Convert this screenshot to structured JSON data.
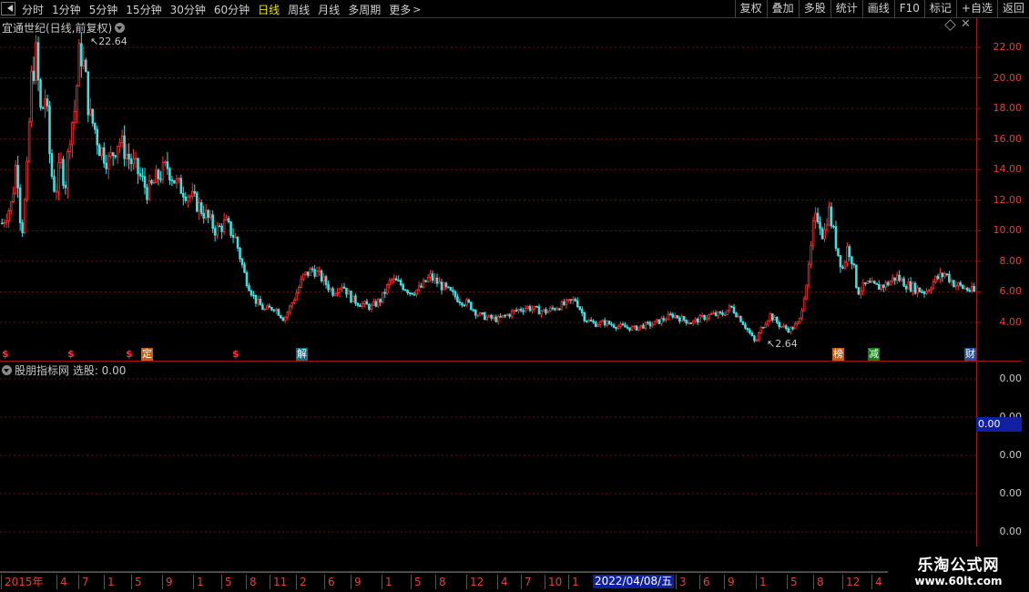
{
  "toolbar": {
    "periods": [
      {
        "label": "分时",
        "active": false
      },
      {
        "label": "1分钟",
        "active": false
      },
      {
        "label": "5分钟",
        "active": false
      },
      {
        "label": "15分钟",
        "active": false
      },
      {
        "label": "30分钟",
        "active": false
      },
      {
        "label": "60分钟",
        "active": false
      },
      {
        "label": "日线",
        "active": true
      },
      {
        "label": "周线",
        "active": false
      },
      {
        "label": "月线",
        "active": false
      },
      {
        "label": "多周期",
        "active": false
      },
      {
        "label": "更多",
        "active": false
      }
    ],
    "more_arrow": ">",
    "actions": [
      "复权",
      "叠加",
      "多股",
      "统计",
      "画线",
      "F10",
      "标记",
      "+自选",
      "返回"
    ]
  },
  "price_panel": {
    "title": "宜通世纪(日线,前复权)",
    "close_glyph": "✕",
    "y_labels": [
      "22.00",
      "20.00",
      "18.00",
      "16.00",
      "14.00",
      "12.00",
      "10.00",
      "8.00",
      "6.00",
      "4.00"
    ],
    "high_annotation": "22.64",
    "low_annotation": "2.64",
    "markers": [
      {
        "label": "$",
        "kind": "dollar",
        "color": "#ff3030"
      },
      {
        "label": "$",
        "kind": "dollar",
        "color": "#ff3030"
      },
      {
        "label": "$",
        "kind": "dollar",
        "color": "#ff3030"
      },
      {
        "label": "定",
        "kind": "box",
        "color": "#c06010"
      },
      {
        "label": "$",
        "kind": "dollar",
        "color": "#ff3030"
      },
      {
        "label": "解",
        "kind": "box",
        "color": "#107080"
      },
      {
        "label": "榜",
        "kind": "box",
        "color": "#c06010"
      },
      {
        "label": "减",
        "kind": "box",
        "color": "#108010"
      },
      {
        "label": "财",
        "kind": "box",
        "color": "#2050a0"
      }
    ]
  },
  "indicator_panel": {
    "title": "股朋指标网 选股: 0.00",
    "y_labels": [
      "0.00",
      "0.00",
      "0.00",
      "0.00",
      "0.00"
    ],
    "current_value": "0.00"
  },
  "time_axis": {
    "ticks": [
      "2015年",
      "4",
      "7",
      "1",
      "5",
      "9",
      "1",
      "5",
      "8",
      "11",
      "2",
      "6",
      "9",
      "1",
      "5",
      "8",
      "12",
      "4",
      "7",
      "10",
      "1",
      "3",
      "6",
      "9",
      "1",
      "5",
      "8",
      "12",
      "4"
    ],
    "cursor_date": "2022/04/08/五"
  },
  "watermark": {
    "title": "乐淘公式网",
    "url": "www.60lt.com"
  },
  "colors": {
    "up_candle": "#ff3030",
    "down_candle": "#40e0e0",
    "grid": "#7a1010",
    "axis_text": "#e04040",
    "cursor_bg": "#1020a0",
    "active_period": "#e8e800"
  },
  "chart_data": {
    "type": "candlestick",
    "title": "宜通世纪(日线,前复权)",
    "ylim": [
      2.0,
      23.5
    ],
    "y_ticks": [
      4,
      6,
      8,
      10,
      12,
      14,
      16,
      18,
      20,
      22
    ],
    "series": [
      {
        "name": "",
        "points": [
          [
            0,
            10.5
          ],
          [
            0.01,
            11.8
          ],
          [
            0.015,
            14.8
          ],
          [
            0.02,
            9.5
          ],
          [
            0.025,
            13.0
          ],
          [
            0.03,
            19.8
          ],
          [
            0.035,
            21.5
          ],
          [
            0.04,
            17.5
          ],
          [
            0.045,
            19.0
          ],
          [
            0.05,
            14.0
          ],
          [
            0.055,
            12.5
          ],
          [
            0.06,
            14.5
          ],
          [
            0.065,
            13.0
          ],
          [
            0.07,
            16.5
          ],
          [
            0.075,
            18.0
          ],
          [
            0.08,
            22.0
          ],
          [
            0.085,
            20.5
          ],
          [
            0.09,
            17.5
          ],
          [
            0.095,
            16.8
          ],
          [
            0.1,
            15.5
          ],
          [
            0.11,
            14.5
          ],
          [
            0.12,
            16.0
          ],
          [
            0.13,
            14.8
          ],
          [
            0.14,
            13.8
          ],
          [
            0.15,
            12.5
          ],
          [
            0.16,
            13.5
          ],
          [
            0.17,
            14.2
          ],
          [
            0.18,
            13.0
          ],
          [
            0.19,
            12.5
          ],
          [
            0.2,
            11.8
          ],
          [
            0.21,
            11.0
          ],
          [
            0.22,
            10.0
          ],
          [
            0.23,
            10.5
          ],
          [
            0.24,
            9.5
          ],
          [
            0.25,
            7.0
          ],
          [
            0.26,
            5.5
          ],
          [
            0.27,
            4.8
          ],
          [
            0.28,
            5.0
          ],
          [
            0.29,
            4.2
          ],
          [
            0.3,
            5.5
          ],
          [
            0.31,
            7.0
          ],
          [
            0.32,
            7.5
          ],
          [
            0.33,
            6.8
          ],
          [
            0.34,
            6.0
          ],
          [
            0.35,
            6.5
          ],
          [
            0.36,
            5.5
          ],
          [
            0.37,
            5.2
          ],
          [
            0.38,
            5.0
          ],
          [
            0.39,
            5.5
          ],
          [
            0.4,
            6.8
          ],
          [
            0.41,
            6.5
          ],
          [
            0.42,
            6.0
          ],
          [
            0.43,
            6.2
          ],
          [
            0.44,
            7.0
          ],
          [
            0.45,
            6.5
          ],
          [
            0.46,
            6.0
          ],
          [
            0.47,
            5.5
          ],
          [
            0.48,
            5.2
          ],
          [
            0.49,
            4.5
          ],
          [
            0.5,
            4.3
          ],
          [
            0.51,
            4.2
          ],
          [
            0.52,
            4.5
          ],
          [
            0.53,
            4.8
          ],
          [
            0.54,
            5.0
          ],
          [
            0.55,
            4.8
          ],
          [
            0.56,
            4.7
          ],
          [
            0.57,
            5.0
          ],
          [
            0.58,
            5.2
          ],
          [
            0.59,
            5.5
          ],
          [
            0.6,
            4.2
          ],
          [
            0.61,
            3.9
          ],
          [
            0.62,
            4.0
          ],
          [
            0.63,
            3.8
          ],
          [
            0.64,
            3.7
          ],
          [
            0.65,
            3.6
          ],
          [
            0.66,
            3.8
          ],
          [
            0.67,
            3.9
          ],
          [
            0.68,
            4.2
          ],
          [
            0.69,
            4.5
          ],
          [
            0.7,
            4.2
          ],
          [
            0.71,
            4.0
          ],
          [
            0.72,
            4.3
          ],
          [
            0.73,
            4.5
          ],
          [
            0.74,
            4.5
          ],
          [
            0.75,
            5.0
          ],
          [
            0.76,
            4.2
          ],
          [
            0.77,
            3.2
          ],
          [
            0.775,
            2.64
          ],
          [
            0.78,
            3.5
          ],
          [
            0.79,
            4.5
          ],
          [
            0.8,
            3.8
          ],
          [
            0.81,
            3.5
          ],
          [
            0.82,
            4.0
          ],
          [
            0.83,
            7.5
          ],
          [
            0.835,
            10.5
          ],
          [
            0.84,
            11.0
          ],
          [
            0.845,
            9.5
          ],
          [
            0.85,
            11.5
          ],
          [
            0.855,
            10.0
          ],
          [
            0.86,
            8.5
          ],
          [
            0.865,
            7.5
          ],
          [
            0.87,
            9.0
          ],
          [
            0.875,
            8.0
          ],
          [
            0.88,
            6.0
          ],
          [
            0.89,
            6.5
          ],
          [
            0.9,
            6.3
          ],
          [
            0.91,
            6.5
          ],
          [
            0.92,
            7.0
          ],
          [
            0.93,
            6.5
          ],
          [
            0.94,
            6.2
          ],
          [
            0.95,
            6.0
          ],
          [
            0.96,
            6.8
          ],
          [
            0.97,
            7.2
          ],
          [
            0.98,
            6.5
          ],
          [
            1.0,
            6.0
          ]
        ]
      }
    ],
    "annotations": [
      "22.64",
      "2.64"
    ]
  }
}
